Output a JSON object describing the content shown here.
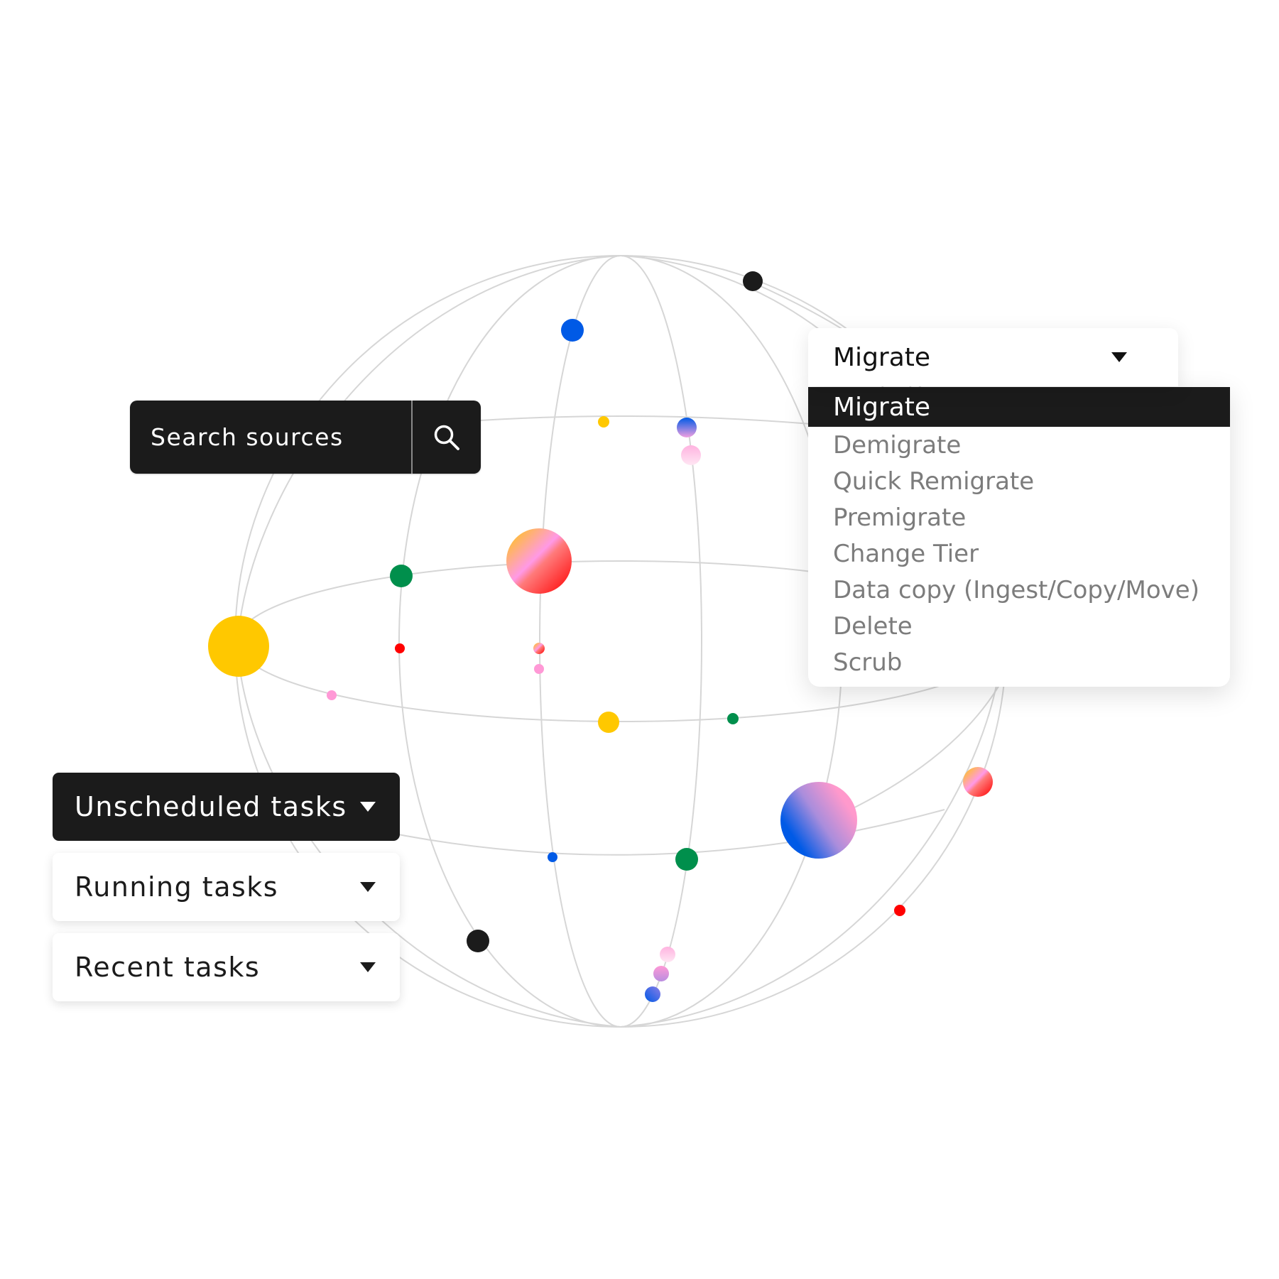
{
  "search": {
    "placeholder": "Search sources",
    "icon": "search-icon"
  },
  "task_panels": [
    {
      "label": "Unscheduled tasks",
      "state": "active",
      "icon": "caret-down-icon"
    },
    {
      "label": "Running tasks",
      "state": "inactive",
      "icon": "caret-down-icon"
    },
    {
      "label": "Recent tasks",
      "state": "inactive",
      "icon": "caret-down-icon"
    }
  ],
  "action_dropdown": {
    "selected": "Migrate",
    "icon": "caret-down-icon",
    "options": [
      "Migrate",
      "Demigrate",
      "Quick Remigrate",
      "Premigrate",
      "Change Tier",
      "Data copy (Ingest/Copy/Move)",
      "Delete",
      "Scrub"
    ],
    "highlighted_index": 0
  },
  "colors": {
    "dark": "#1b1b1b",
    "muted_text": "#7c7c7c",
    "grid": "#d6d6d6",
    "yellow": "#ffc800",
    "green": "#008f4c",
    "blue": "#005ae6",
    "red": "#ff0000",
    "pink": "#ff99d6",
    "black": "#1b1b1b"
  },
  "globe_nodes": [
    {
      "name": "node-black-top",
      "fill": "black"
    },
    {
      "name": "node-blue-top",
      "fill": "blue"
    },
    {
      "name": "node-yellow-small",
      "fill": "yellow"
    },
    {
      "name": "node-blue-pink",
      "fill": "grad-bluepink-v"
    },
    {
      "name": "node-pink-light",
      "fill": "grad-pinklight"
    },
    {
      "name": "node-green-left",
      "fill": "green"
    },
    {
      "name": "node-sunset-large",
      "fill": "grad-sunset"
    },
    {
      "name": "node-yellow-large",
      "fill": "yellow"
    },
    {
      "name": "node-red-small",
      "fill": "red"
    },
    {
      "name": "node-sunset-tiny",
      "fill": "grad-sunset"
    },
    {
      "name": "node-pink-small",
      "fill": "pink"
    },
    {
      "name": "node-pink-equator",
      "fill": "pink"
    },
    {
      "name": "node-yellow-mid",
      "fill": "yellow"
    },
    {
      "name": "node-green-small",
      "fill": "green"
    },
    {
      "name": "node-blue-violet-large",
      "fill": "grad-bluepink"
    },
    {
      "name": "node-sunset-right",
      "fill": "grad-sunset"
    },
    {
      "name": "node-blue-small",
      "fill": "blue"
    },
    {
      "name": "node-green-bottom",
      "fill": "green"
    },
    {
      "name": "node-red-bottom",
      "fill": "red"
    },
    {
      "name": "node-black-bottom",
      "fill": "black"
    },
    {
      "name": "node-pink-faint",
      "fill": "grad-pinklight"
    },
    {
      "name": "node-pink-violet",
      "fill": "grad-pinkviolet"
    },
    {
      "name": "node-blue-bottom",
      "fill": "grad-bluepink-b"
    }
  ]
}
